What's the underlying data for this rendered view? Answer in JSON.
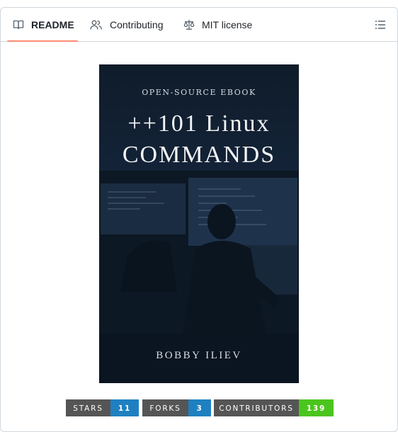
{
  "tabs": [
    {
      "label": "README",
      "icon": "book-icon",
      "active": true
    },
    {
      "label": "Contributing",
      "icon": "people-icon",
      "active": false
    },
    {
      "label": "MIT license",
      "icon": "law-icon",
      "active": false
    }
  ],
  "toc": {
    "icon": "list-icon"
  },
  "cover": {
    "kicker": "OPEN-SOURCE EBOOK",
    "title_line1": "++101 Linux",
    "title_line2": "COMMANDS",
    "author": "BOBBY ILIEV"
  },
  "badges": [
    {
      "label": "STARS",
      "value": "11",
      "color": "#1f80c1"
    },
    {
      "label": "FORKS",
      "value": "3",
      "color": "#1f80c1"
    },
    {
      "label": "CONTRIBUTORS",
      "value": "139",
      "color": "#4bc51d"
    }
  ],
  "colors": {
    "accent_underline": "#fd8c73",
    "border": "#d0d7de",
    "text": "#1f2328"
  }
}
